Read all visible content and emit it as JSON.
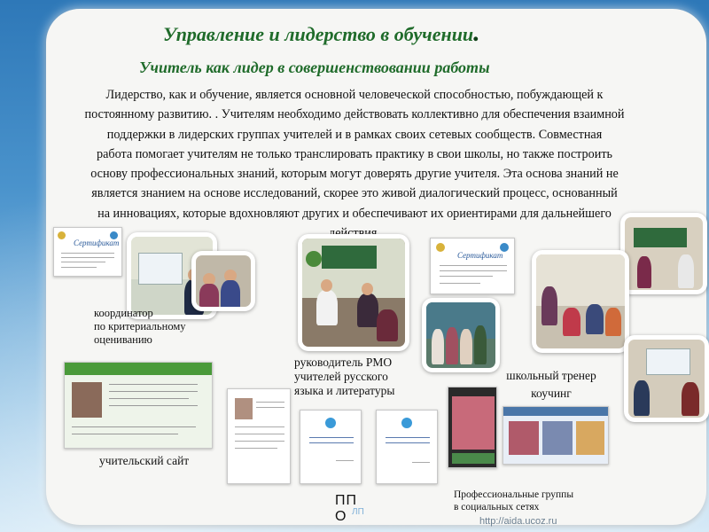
{
  "slide": {
    "title": "Управление и лидерство в обучении",
    "title_dot": ".",
    "subtitle": "Учитель как лидер в совершенствовании работы",
    "body_lines": [
      "Лидерство, как и обучение, является основной человеческой способностью, побуждающей к",
      "постоянному развитию. . Учителям необходимо действовать коллективно для обеспечения взаимной",
      "поддержки в лидерских группах учителей и в рамках своих сетевых сообществ. Совместная",
      "работа помогает учителям не только транслировать практику в свои школы, но также построить",
      "основу профессиональных знаний, которым могут доверять другие учителя. Эта основа знаний не",
      "является знанием на основе исследований, скорее это живой диалогический процесс, основанный",
      "на инновациях, которые вдохновляют других и обеспечивают их ориентирами для дальнейшего",
      "действия."
    ]
  },
  "captions": {
    "coordinator": [
      "координатор",
      "по критериальному",
      "оцениванию"
    ],
    "rmo_head": [
      "руководитель РМО",
      "учителей русского",
      "языка и литературы"
    ],
    "school_trainer": [
      "школьный тренер",
      "коучинг"
    ],
    "teacher_site": "учительский сайт",
    "social_groups": [
      "Профессиональные группы",
      "в социальных сетях"
    ],
    "ppo": [
      "П",
      "П",
      "О"
    ],
    "ppo_ghost": "ЛП"
  },
  "certificates": {
    "left_title": "Сертификат",
    "middle_title": "Сертификат"
  },
  "footer": {
    "url": "http://aida.ucoz.ru"
  },
  "colors": {
    "title_green": "#1f6b2a",
    "background_blue": "#4a93cc",
    "card": "#f6f6f4"
  }
}
